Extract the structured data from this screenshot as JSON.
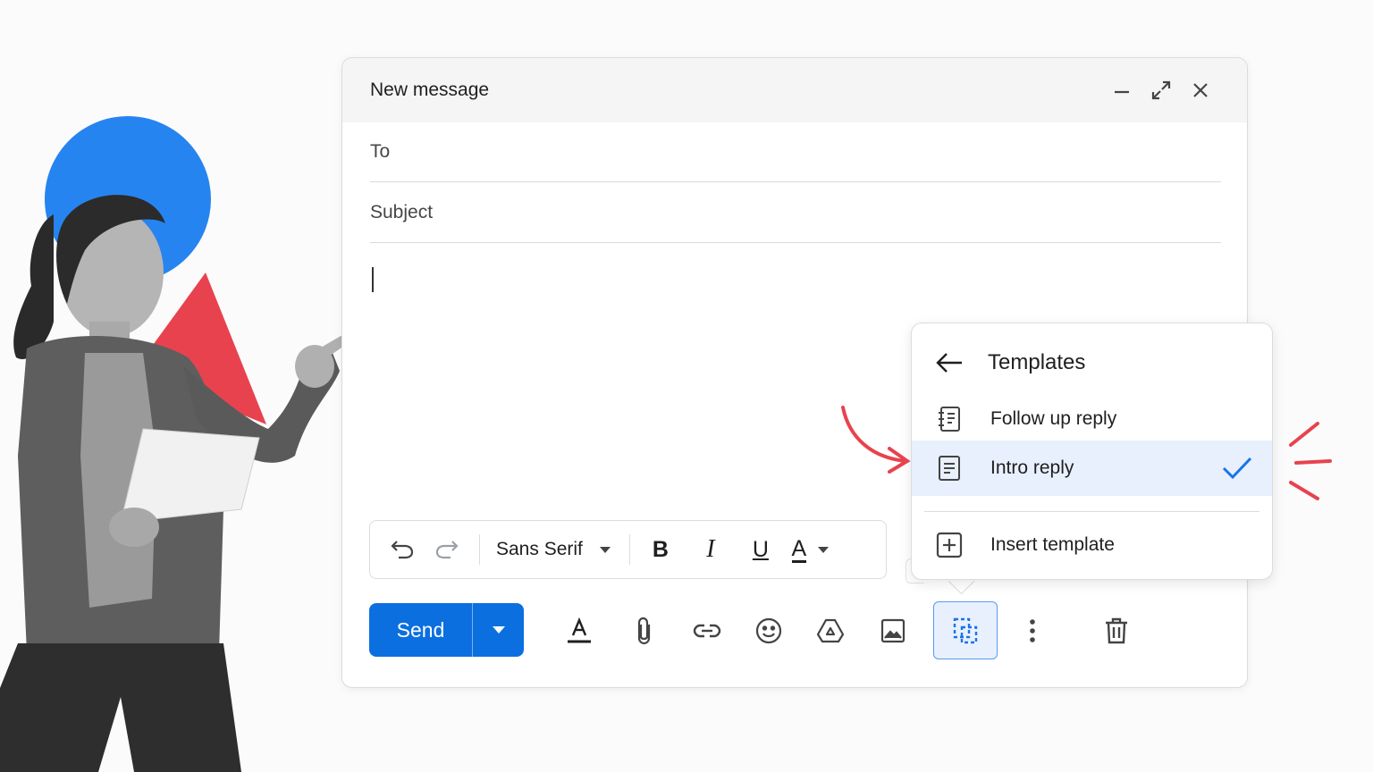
{
  "compose": {
    "title": "New message",
    "to_label": "To",
    "subject_label": "Subject",
    "header_buttons": [
      "minimize-icon",
      "expand-icon",
      "close-icon"
    ]
  },
  "format_toolbar": {
    "font": "Sans Serif",
    "buttons": [
      "undo-icon",
      "redo-icon",
      "bold-icon",
      "italic-icon",
      "underline-icon",
      "text-color-icon"
    ],
    "bold_label": "B",
    "italic_label": "I",
    "underline_label": "U",
    "text_color_label": "A"
  },
  "actions": {
    "send_label": "Send",
    "icons": [
      "formatting-icon",
      "attach-icon",
      "link-icon",
      "emoji-icon",
      "drive-icon",
      "photo-icon",
      "templates-icon",
      "more-options-icon",
      "delete-icon"
    ],
    "active": "templates-icon"
  },
  "templates_menu": {
    "title": "Templates",
    "items": [
      {
        "label": "Follow up reply",
        "icon": "template-doc-icon",
        "selected": false
      },
      {
        "label": "Intro reply",
        "icon": "template-doc-icon",
        "selected": true
      }
    ],
    "insert_label": "Insert template"
  },
  "colors": {
    "accent": "#0b6fe0",
    "selected_bg": "#e8f0fe",
    "deco_blue": "#2684f0",
    "deco_red": "#e8424f"
  }
}
